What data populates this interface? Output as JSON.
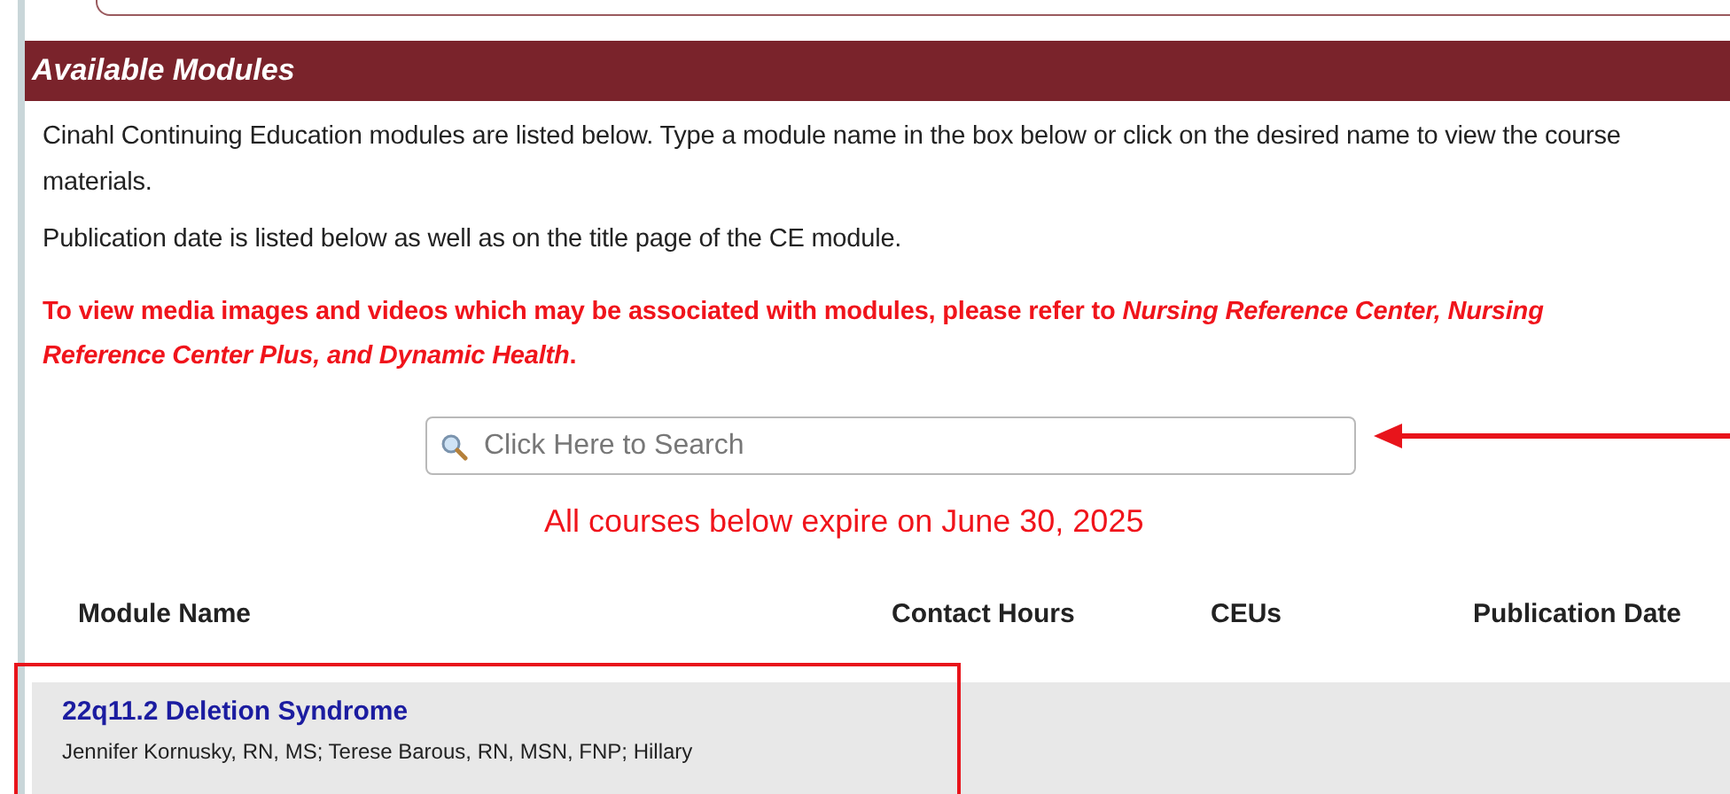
{
  "section": {
    "title": "Available Modules"
  },
  "intro": [
    "Cinahl Continuing Education modules are listed below. Type a module name in the box below or click on the desired name to view the course materials.",
    "Publication date is listed below as well as on the title page of the CE module."
  ],
  "notice": "To view media images and videos which may be associated with modules, please refer to *Nursing Reference Center, Nursing Reference Center Plus, and Dynamic Health*.",
  "search": {
    "placeholder": "Click Here to Search"
  },
  "expiry": "All courses below expire on June 30, 2025",
  "table": {
    "columns": [
      "Module Name",
      "Contact Hours",
      "CEUs",
      "Publication Date"
    ],
    "rows": [
      {
        "name": "22q11.2 Deletion Syndrome",
        "authors": "Jennifer Kornusky, RN, MS; Terese Barous, RN, MSN, FNP; Hillary"
      }
    ]
  }
}
